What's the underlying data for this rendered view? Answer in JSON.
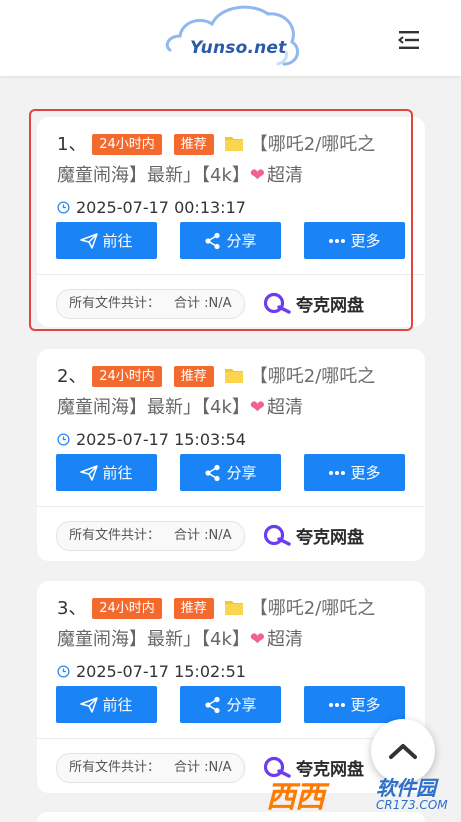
{
  "header": {
    "logo_text": "Yunso.net",
    "menu_icon": "menu-icon"
  },
  "results": [
    {
      "index": "1、",
      "tag_24h": "24小时内",
      "tag_recommend": "推荐",
      "title_part1": "【哪吒2/哪吒之",
      "title_part2": "魔童闹海】最新」【4k】",
      "title_hd": "超清",
      "time": "2025-07-17 00:13:17",
      "btn_go": "前往",
      "btn_share": "分享",
      "btn_more": "更多",
      "stats_label": "所有文件共计：",
      "stats_total": "合计 :N/A",
      "pan_name": "夸克网盘",
      "highlighted": true
    },
    {
      "index": "2、",
      "tag_24h": "24小时内",
      "tag_recommend": "推荐",
      "title_part1": "【哪吒2/哪吒之",
      "title_part2": "魔童闹海】最新」【4k】",
      "title_hd": "超清",
      "time": "2025-07-17 15:03:54",
      "btn_go": "前往",
      "btn_share": "分享",
      "btn_more": "更多",
      "stats_label": "所有文件共计：",
      "stats_total": "合计 :N/A",
      "pan_name": "夸克网盘",
      "highlighted": false
    },
    {
      "index": "3、",
      "tag_24h": "24小时内",
      "tag_recommend": "推荐",
      "title_part1": "【哪吒2/哪吒之",
      "title_part2": "魔童闹海】最新」【4k】",
      "title_hd": "超清",
      "time": "2025-07-17 15:02:51",
      "btn_go": "前往",
      "btn_share": "分享",
      "btn_more": "更多",
      "stats_label": "所有文件共计：",
      "stats_total": "合计 :N/A",
      "pan_name": "夸克网盘",
      "highlighted": false
    }
  ],
  "watermark": {
    "logo": "西西",
    "site": "软件园",
    "url": "CR173.COM"
  },
  "colors": {
    "accent": "#1a83f6",
    "tag": "#f36a2e",
    "highlight_border": "#e0463c"
  }
}
